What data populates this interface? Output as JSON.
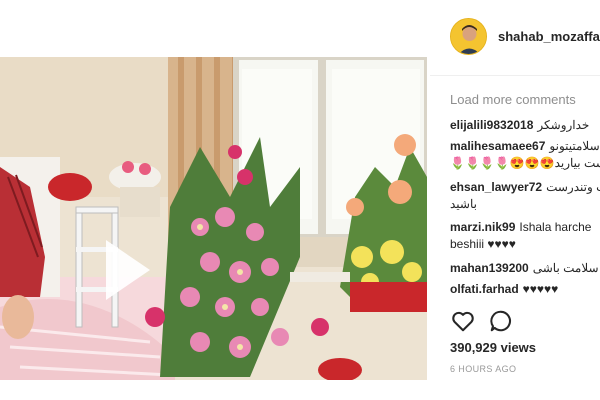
{
  "post": {
    "username": "shahab_mozaffari",
    "load_more": "Load more comments",
    "views": "390,929 views",
    "timestamp": "6 HOURS AGO"
  },
  "comments": [
    {
      "user": "elijalili9832018",
      "text": "خداروشکر",
      "text2": ""
    },
    {
      "user": "malihesamaee67",
      "text": "سلامتیتونو",
      "text2": "🌷🌷🌷🌷😍😍😍دست بیارید"
    },
    {
      "user": "ehsan_lawyer72",
      "text": "ت وتندرست",
      "text2": "باشید"
    },
    {
      "user": "marzi.nik99",
      "text": "Ishala harche",
      "text2": "beshiii ♥♥♥♥"
    },
    {
      "user": "mahan139200",
      "text": "سلامت باشی",
      "text2": ""
    },
    {
      "user": "olfati.farhad",
      "text": "♥♥♥♥♥",
      "text2": ""
    }
  ],
  "icons": {
    "like": "heart-icon",
    "comment": "comment-bubble-icon",
    "play": "play-icon"
  },
  "colors": {
    "username": "#262626",
    "muted": "#8e8e8e",
    "avatar_bg": "#f4c430"
  }
}
